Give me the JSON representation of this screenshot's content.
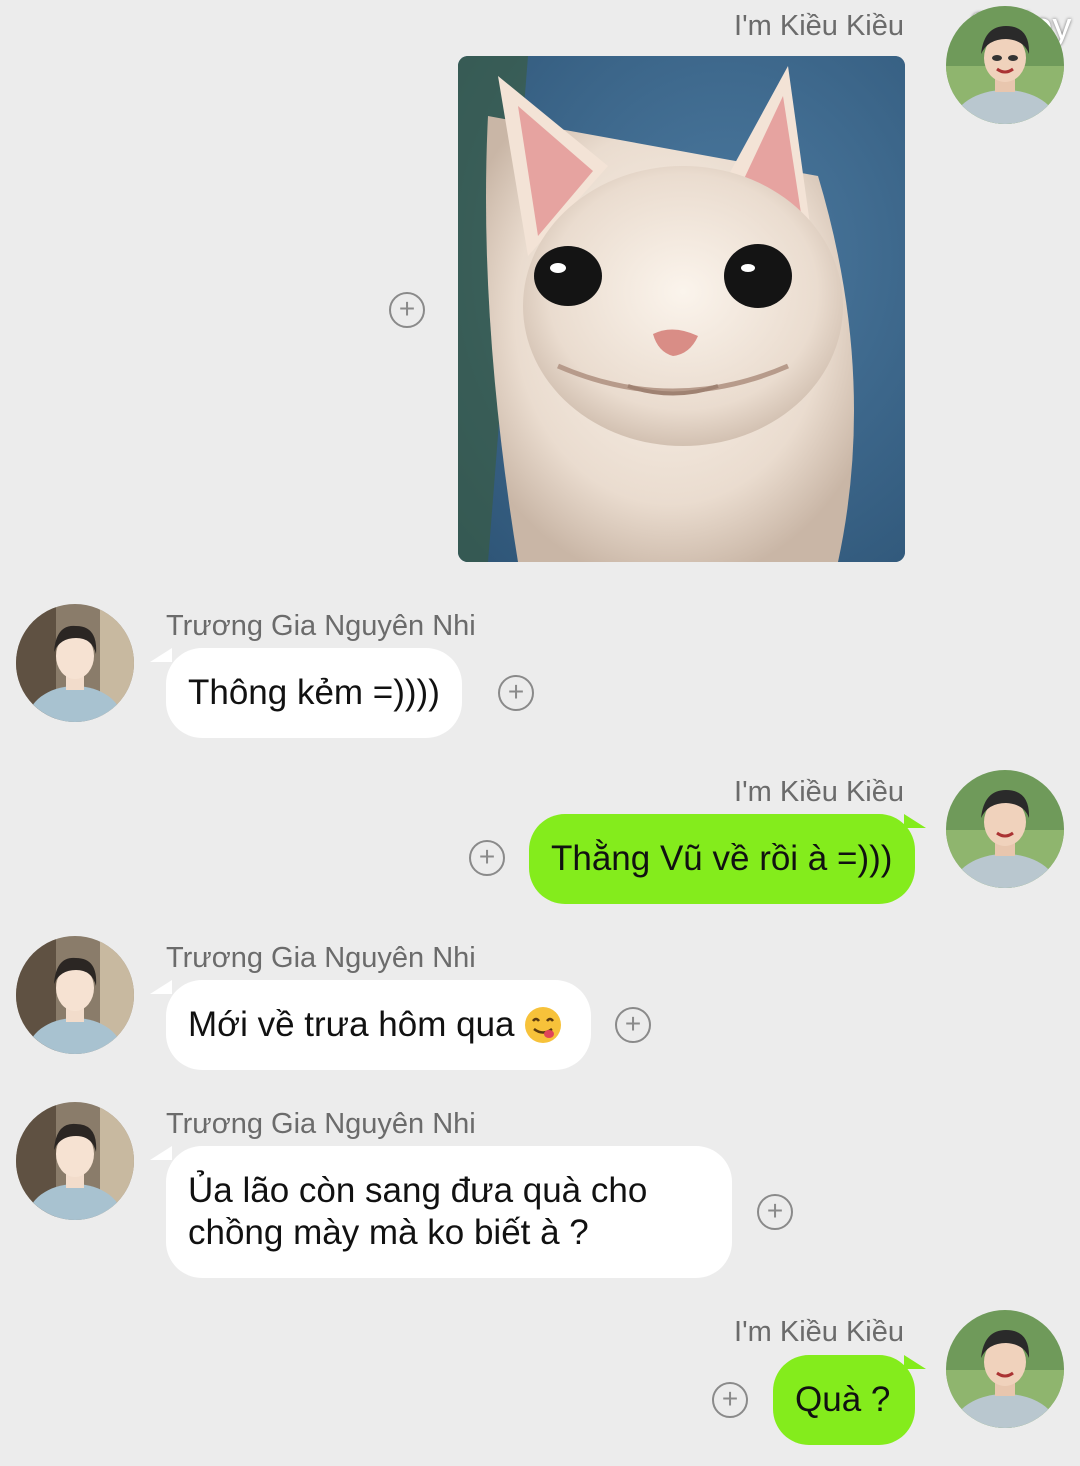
{
  "watermark": "84 joy",
  "me": {
    "name": "I'm Kiều Kiều"
  },
  "friend": {
    "name": "Trương Gia Nguyên Nhi"
  },
  "messages": [
    {
      "sender": "me",
      "type": "image",
      "image_icon": "cat-meme-image"
    },
    {
      "sender": "friend",
      "text": "Thông kẻm =))))"
    },
    {
      "sender": "me",
      "text": "Thằng Vũ về rồi à =)))"
    },
    {
      "sender": "friend",
      "text": "Mới về trưa hôm qua",
      "emoji": "yum-face-emoji"
    },
    {
      "sender": "friend",
      "text_line1": "Ủa lão còn sang đưa quà cho",
      "text_line2": "chồng mày mà ko biết à ?"
    },
    {
      "sender": "me",
      "text": "Quà ?"
    }
  ],
  "action_icon": "add-circle-icon",
  "plus_glyph": "+",
  "colors": {
    "background": "#ececec",
    "incoming_bubble": "#ffffff",
    "outgoing_bubble": "#84ec1c",
    "name_text": "#6b6b6b"
  }
}
